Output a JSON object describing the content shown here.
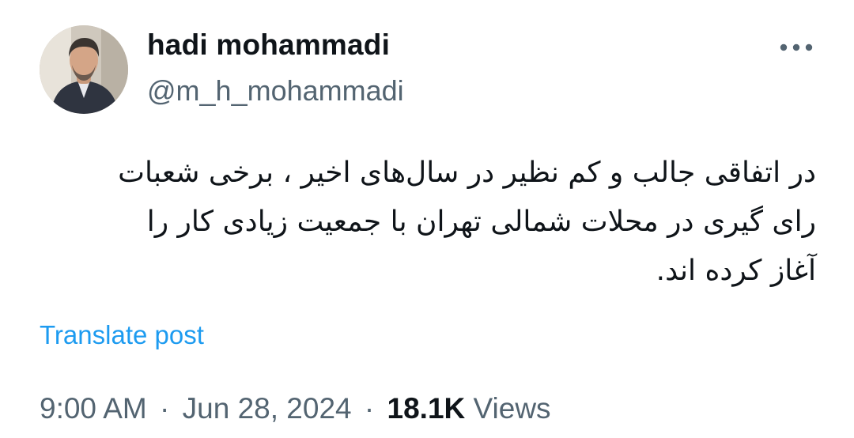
{
  "author": {
    "display_name": "hadi mohammadi",
    "handle": "@m_h_mohammadi",
    "avatar_icon": "profile-photo"
  },
  "menu": {
    "more_icon": "more-horizontal-icon"
  },
  "post": {
    "text_lines": [
      "در اتفاقی جالب و کم نظیر در سال‌های اخیر ، برخی شعبات",
      "رای گیری در محلات شمالی تهران با جمعیت زیادی کار را",
      "آغاز کرده اند."
    ],
    "translate_label": "Translate post"
  },
  "meta": {
    "time": "9:00 AM",
    "separator": "·",
    "date": "Jun 28, 2024",
    "views_count": "18.1K",
    "views_label": "Views"
  },
  "colors": {
    "text": "#0f1419",
    "secondary": "#536471",
    "link": "#1d9bf0",
    "background": "#ffffff"
  }
}
